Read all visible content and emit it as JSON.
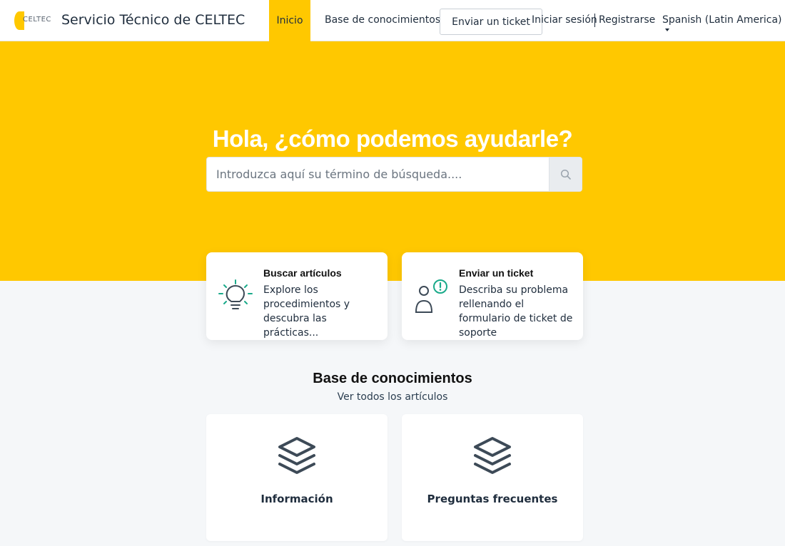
{
  "header": {
    "logo_text": "CELTEC",
    "site_title": "Servicio Técnico de CELTEC",
    "nav": {
      "home": "Inicio",
      "knowledge_base": "Base de conocimientos",
      "submit_ticket": "Enviar un ticket",
      "login": "Iniciar sesión",
      "register": "Registrarse",
      "language": "Spanish (Latin America)"
    }
  },
  "hero": {
    "title": "Hola, ¿cómo podemos ayudarle?",
    "search_placeholder": "Introduzca aquí su término de búsqueda...."
  },
  "actions": [
    {
      "title": "Buscar artículos",
      "description": "Explore los procedimientos y descubra las prácticas..."
    },
    {
      "title": "Enviar un ticket",
      "description": "Describa su problema rellenando el formulario de ticket de soporte"
    }
  ],
  "kb": {
    "heading": "Base de conocimientos",
    "view_all": "Ver todos los artículos",
    "categories": [
      {
        "title": "Información"
      },
      {
        "title": "Preguntas frecuentes"
      }
    ]
  },
  "colors": {
    "brand": "#ffc800",
    "icon_teal": "#1aaa8a",
    "icon_dark": "#3d4a57"
  }
}
